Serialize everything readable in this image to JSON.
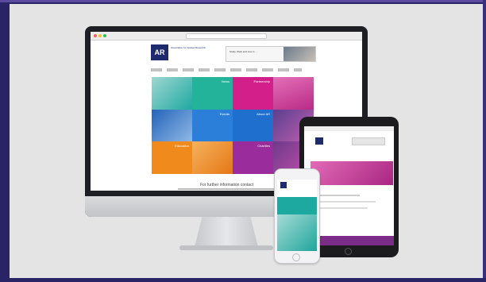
{
  "site": {
    "logo_mark": "AR",
    "logo_text": "Association for Applied Research",
    "banner_text": "Study, Work and Live in ...",
    "tiles": [
      "News",
      "Partnership",
      "Events",
      "About AR",
      "Education",
      "Charities"
    ],
    "footer_title": "For further information contact"
  },
  "colors": {
    "background_border": "#2a2466",
    "frame": "#e4e4e4",
    "accent_magenta": "#c2308a",
    "accent_teal": "#1ea9a0",
    "accent_blue": "#2b7fd8",
    "accent_orange": "#f08a1c"
  }
}
